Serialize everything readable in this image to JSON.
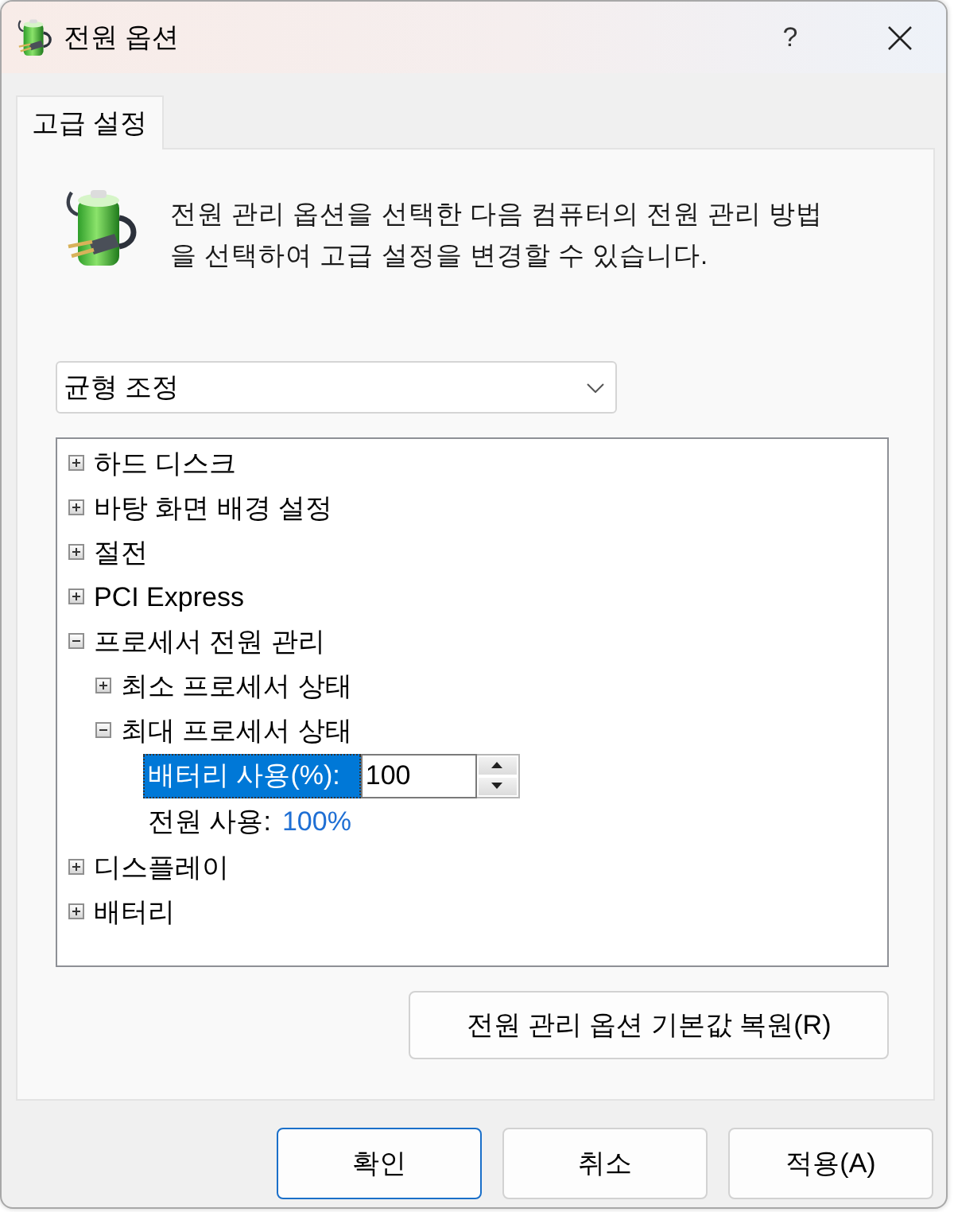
{
  "window": {
    "title": "전원 옵션",
    "help": "?"
  },
  "tabs": [
    {
      "label": "고급 설정",
      "selected": true
    }
  ],
  "description": "전원 관리 옵션을 선택한 다음 컴퓨터의 전원 관리 방법을 선택하여 고급 설정을 변경할 수 있습니다.",
  "plan_dropdown": {
    "value": "균형 조정"
  },
  "settings_tree": [
    {
      "kind": "group",
      "label": "하드 디스크",
      "expanded": false
    },
    {
      "kind": "group",
      "label": "바탕 화면 배경 설정",
      "expanded": false
    },
    {
      "kind": "group",
      "label": "절전",
      "expanded": false
    },
    {
      "kind": "group",
      "label": "PCI Express",
      "expanded": false
    },
    {
      "kind": "group",
      "label": "프로세서 전원 관리",
      "expanded": true,
      "children": [
        {
          "kind": "group",
          "label": "최소 프로세서 상태",
          "expanded": false
        },
        {
          "kind": "group",
          "label": "최대 프로세서 상태",
          "expanded": true,
          "children": [
            {
              "kind": "spin_setting",
              "label": "배터리 사용(%):",
              "value": "100",
              "selected": true
            },
            {
              "kind": "link_setting",
              "label": "전원 사용:",
              "value": "100%",
              "selected": false
            }
          ]
        }
      ]
    },
    {
      "kind": "group",
      "label": "디스플레이",
      "expanded": false
    },
    {
      "kind": "group",
      "label": "배터리",
      "expanded": false
    }
  ],
  "restore_button": "전원 관리 옵션 기본값 복원(R)",
  "dialog_buttons": [
    {
      "label": "확인",
      "default": true
    },
    {
      "label": "취소",
      "default": false
    },
    {
      "label": "적용(A)",
      "default": false
    }
  ]
}
